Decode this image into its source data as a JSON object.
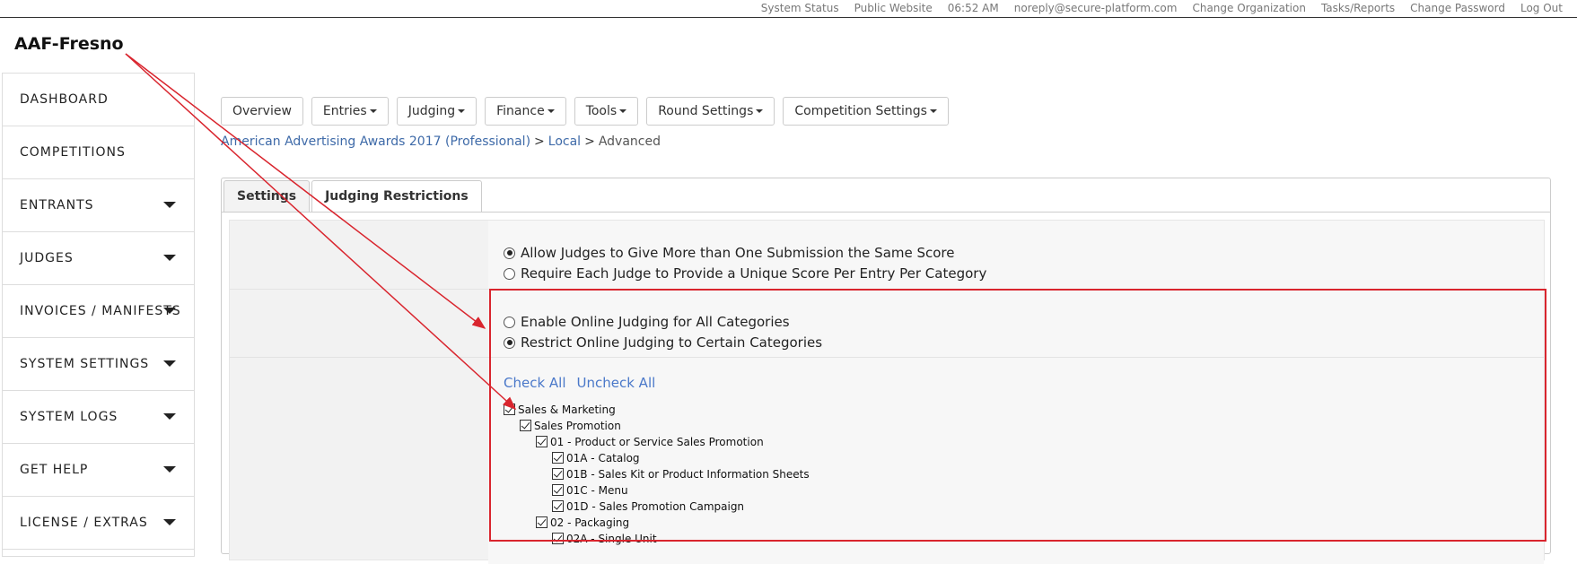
{
  "topbar": {
    "links": [
      "System Status",
      "Public Website",
      "06:52 AM",
      "noreply@secure-platform.com",
      "Change Organization",
      "Tasks/Reports",
      "Change Password",
      "Log Out"
    ]
  },
  "org": {
    "name": "AAF-Fresno"
  },
  "sidebar": {
    "items": [
      {
        "label": "DASHBOARD",
        "caret": false
      },
      {
        "label": "COMPETITIONS",
        "caret": false
      },
      {
        "label": "ENTRANTS",
        "caret": true
      },
      {
        "label": "JUDGES",
        "caret": true
      },
      {
        "label": "INVOICES / MANIFESTS",
        "caret": true
      },
      {
        "label": "SYSTEM SETTINGS",
        "caret": true
      },
      {
        "label": "SYSTEM LOGS",
        "caret": true
      },
      {
        "label": "GET HELP",
        "caret": true
      },
      {
        "label": "LICENSE / EXTRAS",
        "caret": true
      }
    ]
  },
  "toolbar": {
    "overview": "Overview",
    "entries": "Entries",
    "judging": "Judging",
    "finance": "Finance",
    "tools": "Tools",
    "round_settings": "Round Settings",
    "competition_settings": "Competition Settings"
  },
  "breadcrumb": {
    "competition": "American Advertising Awards 2017 (Professional)",
    "round": "Local",
    "current": "Advanced",
    "separator": ">"
  },
  "tabs": {
    "settings": "Settings",
    "judging_restrictions": "Judging Restrictions"
  },
  "scoring": {
    "allow_same_score": "Allow Judges to Give More than One Submission the Same Score",
    "require_unique": "Require Each Judge to Provide a Unique Score Per Entry Per Category",
    "selected": "allow_same_score"
  },
  "online_judging": {
    "enable_all": "Enable Online Judging for All Categories",
    "restrict": "Restrict Online Judging to Certain Categories",
    "selected": "restrict"
  },
  "category_actions": {
    "check_all": "Check All",
    "uncheck_all": "Uncheck All"
  },
  "categories": [
    {
      "label": "Sales & Marketing",
      "level": 0,
      "checked": true
    },
    {
      "label": "Sales Promotion",
      "level": 1,
      "checked": true
    },
    {
      "label": "01 - Product or Service Sales Promotion",
      "level": 2,
      "checked": true
    },
    {
      "label": "01A - Catalog",
      "level": 3,
      "checked": true
    },
    {
      "label": "01B - Sales Kit or Product Information Sheets",
      "level": 3,
      "checked": true
    },
    {
      "label": "01C - Menu",
      "level": 3,
      "checked": true
    },
    {
      "label": "01D - Sales Promotion Campaign",
      "level": 3,
      "checked": true
    },
    {
      "label": "02 - Packaging",
      "level": 2,
      "checked": true
    },
    {
      "label": "02A - Single Unit",
      "level": 3,
      "checked": true
    }
  ],
  "colors": {
    "annotation_red": "#d9252e",
    "link_blue": "#4a78c9",
    "breadcrumb_blue": "#3e6aa8"
  }
}
